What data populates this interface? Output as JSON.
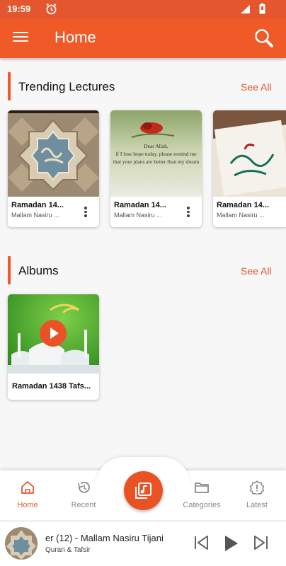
{
  "status_bar": {
    "time": "19:59"
  },
  "app_bar": {
    "title": "Home"
  },
  "trending": {
    "title": "Trending Lectures",
    "see_all": "See All",
    "items": [
      {
        "title": "Ramadan 14...",
        "subtitle": "Mallam Nasiru ..."
      },
      {
        "title": "Ramadan 14...",
        "subtitle": "Mallam Nasiru ..."
      },
      {
        "title": "Ramadan 14...",
        "subtitle": "Mallam Nasiru ..."
      }
    ],
    "quote_lines": [
      "Dear Allah,",
      "if I lose hope today, please remind me",
      "that your plans are better than my dream"
    ]
  },
  "albums": {
    "title": "Albums",
    "see_all": "See All",
    "items": [
      {
        "title": "Ramadan 1438 Tafs..."
      }
    ]
  },
  "bottom_nav": {
    "home": "Home",
    "recent": "Recent",
    "categories": "Categories",
    "latest": "Latest"
  },
  "player": {
    "title": "er (12) - Mallam Nasiru Tijani",
    "subtitle": "Quran & Tafsir"
  },
  "colors": {
    "accent": "#f05a28",
    "status_bar": "#e4572e"
  }
}
